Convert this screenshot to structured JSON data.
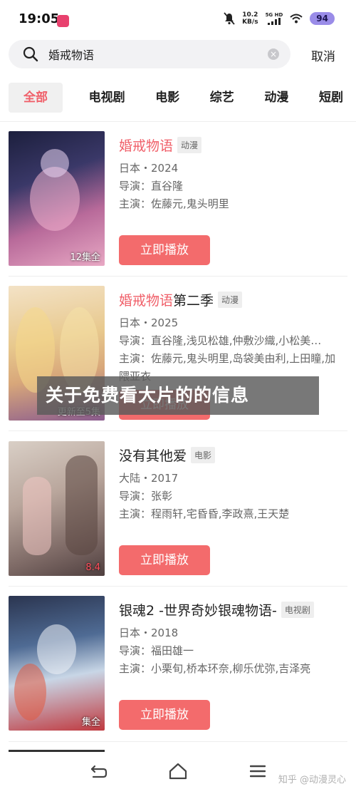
{
  "status_bar": {
    "time": "19:05",
    "net_speed_value": "10.2",
    "net_speed_unit": "KB/s",
    "signal_label": "5G HD",
    "battery": "94"
  },
  "search": {
    "query": "婚戒物语",
    "cancel_label": "取消"
  },
  "tabs": [
    {
      "label": "全部",
      "active": true
    },
    {
      "label": "电视剧",
      "active": false
    },
    {
      "label": "电影",
      "active": false
    },
    {
      "label": "综艺",
      "active": false
    },
    {
      "label": "动漫",
      "active": false
    },
    {
      "label": "短剧",
      "active": false
    }
  ],
  "results": [
    {
      "title_highlight": "婚戒物语",
      "title_rest": "",
      "type": "动漫",
      "region_year": "日本・2024",
      "director": "导演：直谷隆",
      "cast": "主演：佐藤元,鬼头明里",
      "poster_text": "12集全",
      "play_label": "立即播放"
    },
    {
      "title_highlight": "婚戒物语",
      "title_rest": "第二季",
      "type": "动漫",
      "region_year": "日本・2025",
      "director": "导演：直谷隆,浅见松雄,仲敷沙織,小松美…",
      "cast": "主演：佐藤元,鬼头明里,岛袋美由利,上田瞳,加隈亚衣",
      "poster_text": "更新至5集",
      "play_label": "立即播放"
    },
    {
      "title_highlight": "",
      "title_rest": "没有其他爱",
      "type": "电影",
      "region_year": "大陆・2017",
      "director": "导演：张彰",
      "cast": "主演：程雨轩,宅昏昏,李政熹,王天楚",
      "poster_text": "8.4",
      "play_label": "立即播放"
    },
    {
      "title_highlight": "",
      "title_rest": "银魂2 -世界奇妙银魂物语-",
      "type": "电视剧",
      "region_year": "日本・2018",
      "director": "导演：福田雄一",
      "cast": "主演：小栗旬,桥本环奈,柳乐优弥,吉泽亮",
      "poster_text": "集全",
      "play_label": "立即播放"
    }
  ],
  "banner_text": "关于免费看大片的的信息",
  "watermark": "知乎 @动漫灵心",
  "colors": {
    "accent": "#f0606a",
    "play_button": "#f36b6c",
    "battery": "#9a8ce8"
  }
}
